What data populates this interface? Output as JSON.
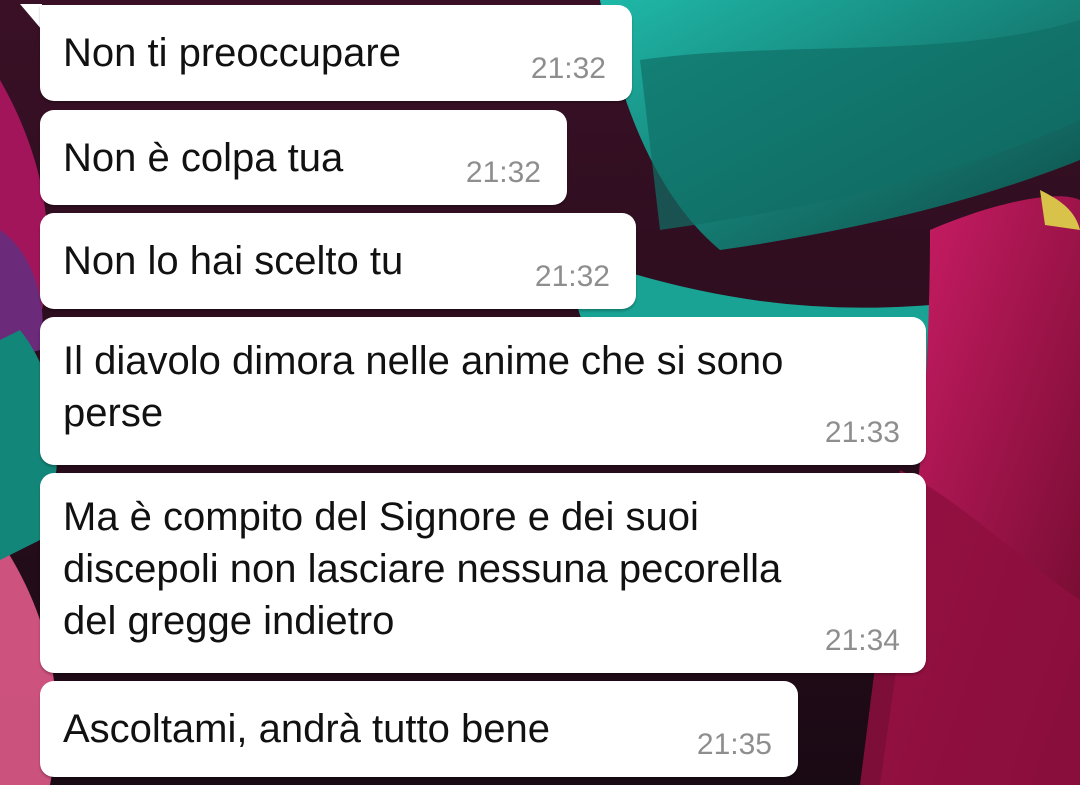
{
  "wallpaper": {
    "colors": {
      "teal": "#1fb8a8",
      "dark_teal": "#0d4a46",
      "magenta": "#b0195a",
      "crimson": "#7a0c2e",
      "purple": "#6b2a7a",
      "pink": "#e05a8a"
    }
  },
  "messages": [
    {
      "text": "Non ti preoccupare",
      "time": "21:32"
    },
    {
      "text": "Non è colpa tua",
      "time": "21:32"
    },
    {
      "text": "Non lo hai scelto tu",
      "time": "21:32"
    },
    {
      "text": "Il diavolo dimora nelle anime che si sono\nperse",
      "time": "21:33"
    },
    {
      "text": "Ma è compito del Signore e dei suoi\ndiscepoli non lasciare nessuna pecorella\ndel gregge indietro",
      "time": "21:34"
    },
    {
      "text": "Ascoltami, andrà tutto bene",
      "time": "21:35"
    }
  ]
}
